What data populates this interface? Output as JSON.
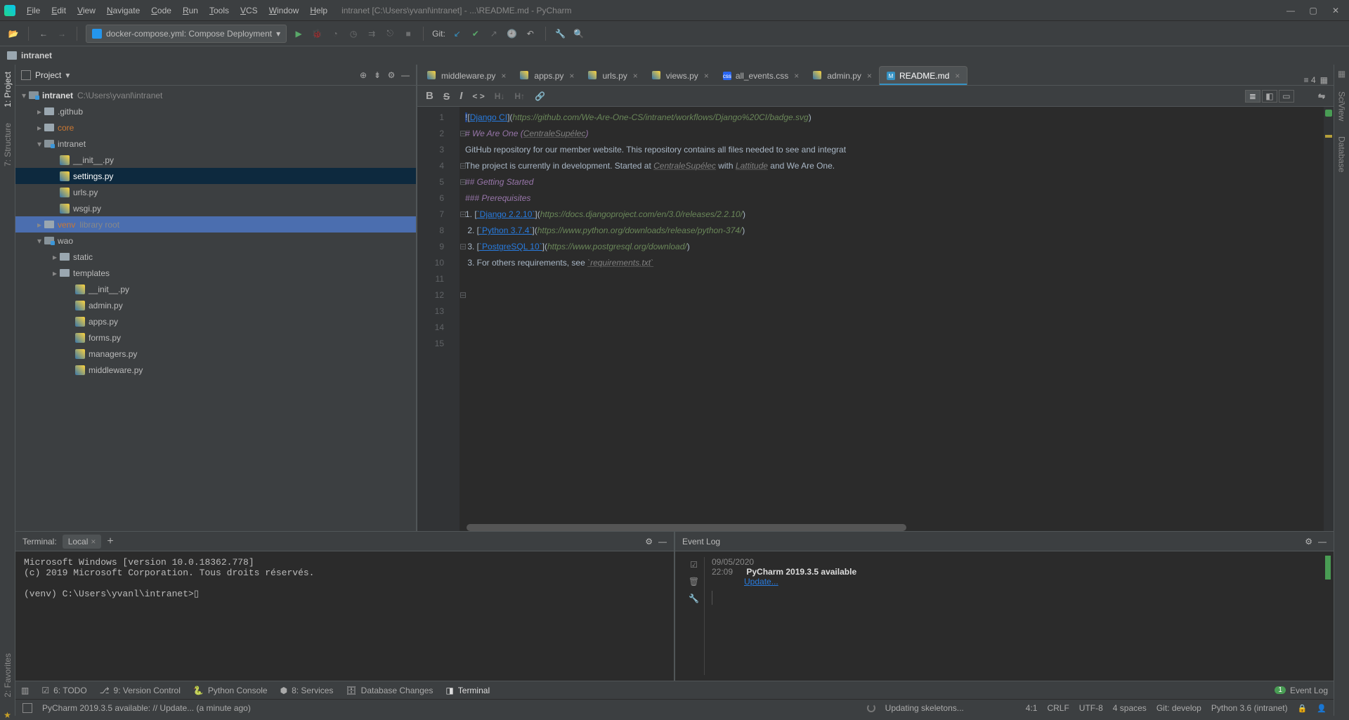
{
  "window": {
    "title": "intranet [C:\\Users\\yvanl\\intranet] - ...\\README.md - PyCharm"
  },
  "menu": [
    "File",
    "Edit",
    "View",
    "Navigate",
    "Code",
    "Run",
    "Tools",
    "VCS",
    "Window",
    "Help"
  ],
  "run_config": {
    "label": "docker-compose.yml: Compose Deployment"
  },
  "git_label": "Git:",
  "breadcrumb": {
    "root": "intranet"
  },
  "left_tabs": {
    "project": "1: Project",
    "structure": "7: Structure",
    "favorites": "2: Favorites"
  },
  "right_tabs": {
    "sciview": "SciView",
    "database": "Database"
  },
  "project_panel": {
    "title": "Project",
    "root": {
      "name": "intranet",
      "path": "C:\\Users\\yvanl\\intranet"
    },
    "items": [
      {
        "depth": 1,
        "arrow": "▸",
        "icon": "folder",
        "label": ".github"
      },
      {
        "depth": 1,
        "arrow": "▸",
        "icon": "folder",
        "label": "core",
        "cls": "orange"
      },
      {
        "depth": 1,
        "arrow": "▾",
        "icon": "folder-mod",
        "label": "intranet"
      },
      {
        "depth": 2,
        "arrow": "",
        "icon": "py",
        "label": "__init__.py"
      },
      {
        "depth": 2,
        "arrow": "",
        "icon": "py",
        "label": "settings.py",
        "sel": "soft"
      },
      {
        "depth": 2,
        "arrow": "",
        "icon": "py",
        "label": "urls.py"
      },
      {
        "depth": 2,
        "arrow": "",
        "icon": "py",
        "label": "wsgi.py"
      },
      {
        "depth": 1,
        "arrow": "▸",
        "icon": "folder",
        "label": "venv",
        "suffix": "library root",
        "cls": "orange",
        "sel": "hard"
      },
      {
        "depth": 1,
        "arrow": "▾",
        "icon": "folder-mod",
        "label": "wao"
      },
      {
        "depth": 2,
        "arrow": "▸",
        "icon": "folder",
        "label": "static"
      },
      {
        "depth": 2,
        "arrow": "▸",
        "icon": "folder",
        "label": "templates"
      },
      {
        "depth": 3,
        "arrow": "",
        "icon": "py",
        "label": "__init__.py"
      },
      {
        "depth": 3,
        "arrow": "",
        "icon": "py",
        "label": "admin.py"
      },
      {
        "depth": 3,
        "arrow": "",
        "icon": "py",
        "label": "apps.py"
      },
      {
        "depth": 3,
        "arrow": "",
        "icon": "py",
        "label": "forms.py"
      },
      {
        "depth": 3,
        "arrow": "",
        "icon": "py",
        "label": "managers.py"
      },
      {
        "depth": 3,
        "arrow": "",
        "icon": "py",
        "label": "middleware.py"
      }
    ]
  },
  "tabs": [
    {
      "icon": "py",
      "label": "middleware.py"
    },
    {
      "icon": "py",
      "label": "apps.py"
    },
    {
      "icon": "py",
      "label": "urls.py"
    },
    {
      "icon": "py",
      "label": "views.py"
    },
    {
      "icon": "css",
      "label": "all_events.css"
    },
    {
      "icon": "py",
      "label": "admin.py"
    },
    {
      "icon": "md",
      "label": "README.md",
      "active": true
    }
  ],
  "tabs_extra": "≡ 4",
  "md_toolbar": {
    "bold": "B",
    "strike": "S",
    "italic": "I",
    "code": "< >",
    "h_dec": "H↓",
    "h_inc": "H↑",
    "link": "🔗"
  },
  "editor": {
    "lines": [
      {
        "n": 1,
        "html": "![<lnk>Django CI</lnk>](<url>https://github.com/We-Are-One-CS/intranet/workflows/Django%20CI/badge.svg</url>)"
      },
      {
        "n": 2,
        "html": "<hdr># We Are One (</hdr><emph>CentraleSupélec</emph><hdr>)</hdr>"
      },
      {
        "n": 3,
        "html": ""
      },
      {
        "n": 4,
        "html": "GitHub repository for our member website. This repository contains all files needed to see and integrat"
      },
      {
        "n": 5,
        "html": "The project is currently in development. Started at <emph>CentraleSupélec</emph> with <emph>Lattitude</emph> and We Are One."
      },
      {
        "n": 6,
        "html": ""
      },
      {
        "n": 7,
        "html": "<hdr>## Getting Started</hdr>"
      },
      {
        "n": 8,
        "html": ""
      },
      {
        "n": 9,
        "html": "<hdr>### Prerequisites</hdr>"
      },
      {
        "n": 10,
        "html": ""
      },
      {
        "n": 11,
        "html": ""
      },
      {
        "n": 12,
        "html": "1. [<lnk>`Django 2.2.10`</lnk>](<url>https://docs.djangoproject.com/en/3.0/releases/2.2.10/</url>)"
      },
      {
        "n": 13,
        "html": " 2. [<lnk>`Python 3.7.4`</lnk>](<url>https://www.python.org/downloads/release/python-374/</url>)"
      },
      {
        "n": 14,
        "html": " 3. [<lnk>`PostgreSQL 10`</lnk>](<url>https://www.postgresql.org/download/</url>)"
      },
      {
        "n": 15,
        "html": " 3. For others requirements, see <emph>`requirements.txt`</emph>"
      }
    ]
  },
  "terminal": {
    "title": "Terminal:",
    "tab": "Local",
    "lines": [
      "Microsoft Windows [version 10.0.18362.778]",
      "(c) 2019 Microsoft Corporation. Tous droits réservés.",
      "",
      "(venv) C:\\Users\\yvanl\\intranet>▯"
    ]
  },
  "event_log": {
    "title": "Event Log",
    "date": "09/05/2020",
    "time": "22:09",
    "msg": "PyCharm 2019.3.5 available",
    "action": "Update..."
  },
  "bottom_tabs": {
    "todo": "6: TODO",
    "vcs": "9: Version Control",
    "pyconsole": "Python Console",
    "services": "8: Services",
    "dbchanges": "Database Changes",
    "terminal": "Terminal",
    "eventlog": "Event Log"
  },
  "status": {
    "msg": "PyCharm 2019.3.5 available: // Update... (a minute ago)",
    "bg": "Updating skeletons...",
    "pos": "4:1",
    "eol": "CRLF",
    "enc": "UTF-8",
    "indent": "4 spaces",
    "branch": "Git: develop",
    "python": "Python 3.6 (intranet)"
  }
}
